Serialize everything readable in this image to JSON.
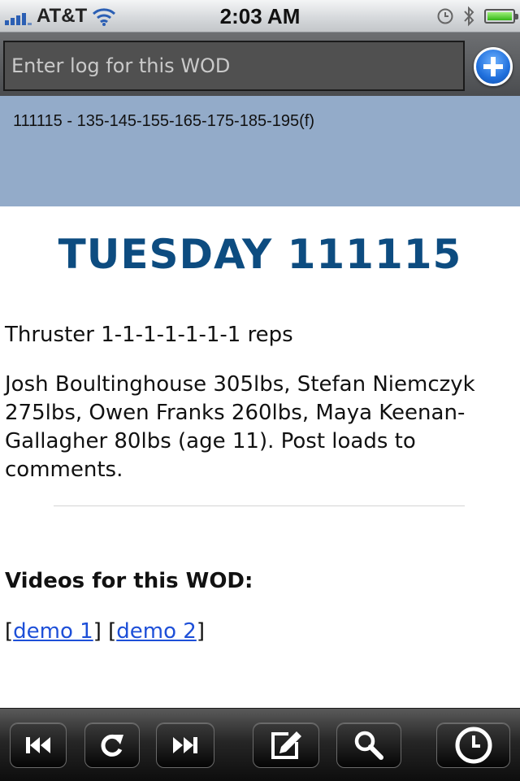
{
  "status_bar": {
    "carrier": "AT&T",
    "time": "2:03 AM"
  },
  "log_entry": {
    "placeholder": "Enter log for this WOD"
  },
  "log_history": {
    "entry": "111115 - 135-145-155-165-175-185-195(f)"
  },
  "wod": {
    "title": "TUESDAY 111115",
    "movement": "Thruster 1-1-1-1-1-1-1 reps",
    "description": "Josh Boultinghouse 305lbs, Stefan Niemczyk 275lbs, Owen Franks 260lbs, Maya Keenan-Gallagher 80lbs (age 11). Post loads to comments.",
    "videos_heading": "Videos for this WOD:",
    "video_links": {
      "bracket_open_1": "[",
      "link_1": "demo 1",
      "bracket_close_1": "] ",
      "bracket_open_2": "[",
      "link_2": "demo 2",
      "bracket_close_2": "]"
    }
  },
  "toolbar": {
    "icons": [
      "rewind-icon",
      "refresh-icon",
      "fast-forward-icon",
      "compose-icon",
      "search-icon",
      "clock-icon"
    ]
  },
  "colors": {
    "title_blue": "#0d4c80",
    "log_area_bg": "#93abc9",
    "link_blue": "#1d4fd8"
  }
}
